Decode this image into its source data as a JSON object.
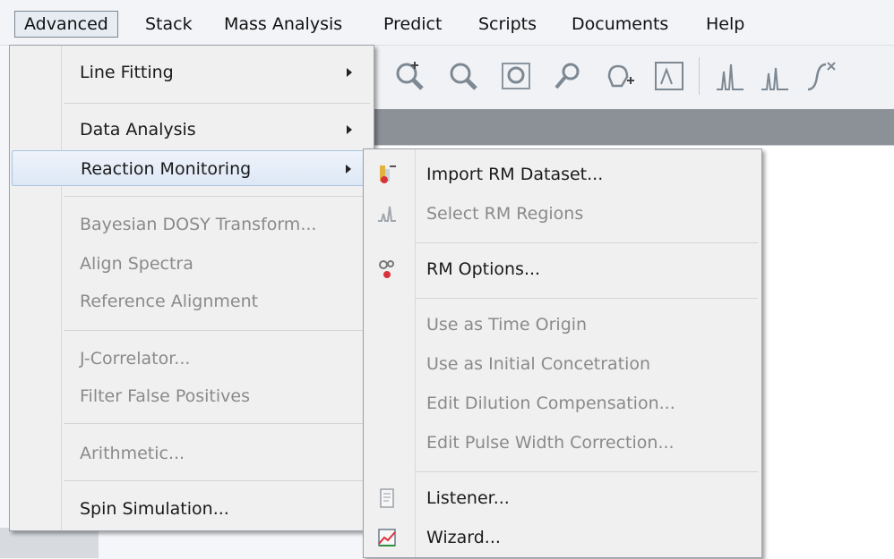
{
  "menubar": {
    "items": [
      "Advanced",
      "Stack",
      "Mass Analysis",
      "Predict",
      "Scripts",
      "Documents",
      "Help"
    ]
  },
  "toolbar": {
    "icons": [
      "zoom-in-icon",
      "zoom-out-icon",
      "zoom-fit-icon",
      "magic-zoom-icon",
      "pan-icon",
      "scale-icon",
      "peak-pick-icon",
      "multiplet-icon",
      "integrate-icon"
    ]
  },
  "advanced_menu": {
    "line_fitting": "Line Fitting",
    "data_analysis": "Data Analysis",
    "reaction_monitoring": "Reaction Monitoring",
    "bayesian_dosy": "Bayesian DOSY Transform...",
    "align_spectra": "Align Spectra",
    "reference_alignment": "Reference Alignment",
    "j_correlator": "J-Correlator...",
    "filter_false_positives": "Filter False Positives",
    "arithmetic": "Arithmetic...",
    "spin_simulation": "Spin Simulation..."
  },
  "rm_submenu": {
    "import_rm_dataset": "Import RM Dataset...",
    "select_rm_regions": "Select RM Regions",
    "rm_options": "RM Options...",
    "use_as_time_origin": "Use as Time Origin",
    "use_as_initial_concentration": "Use as Initial Concetration",
    "edit_dilution_compensation": "Edit Dilution Compensation...",
    "edit_pulse_width_correction": "Edit Pulse Width Correction...",
    "listener": "Listener...",
    "wizard": "Wizard..."
  },
  "colors": {
    "highlight": "#dde8f6",
    "disabled_text": "#8a8a8a",
    "menu_bg": "#f0f0f0"
  }
}
